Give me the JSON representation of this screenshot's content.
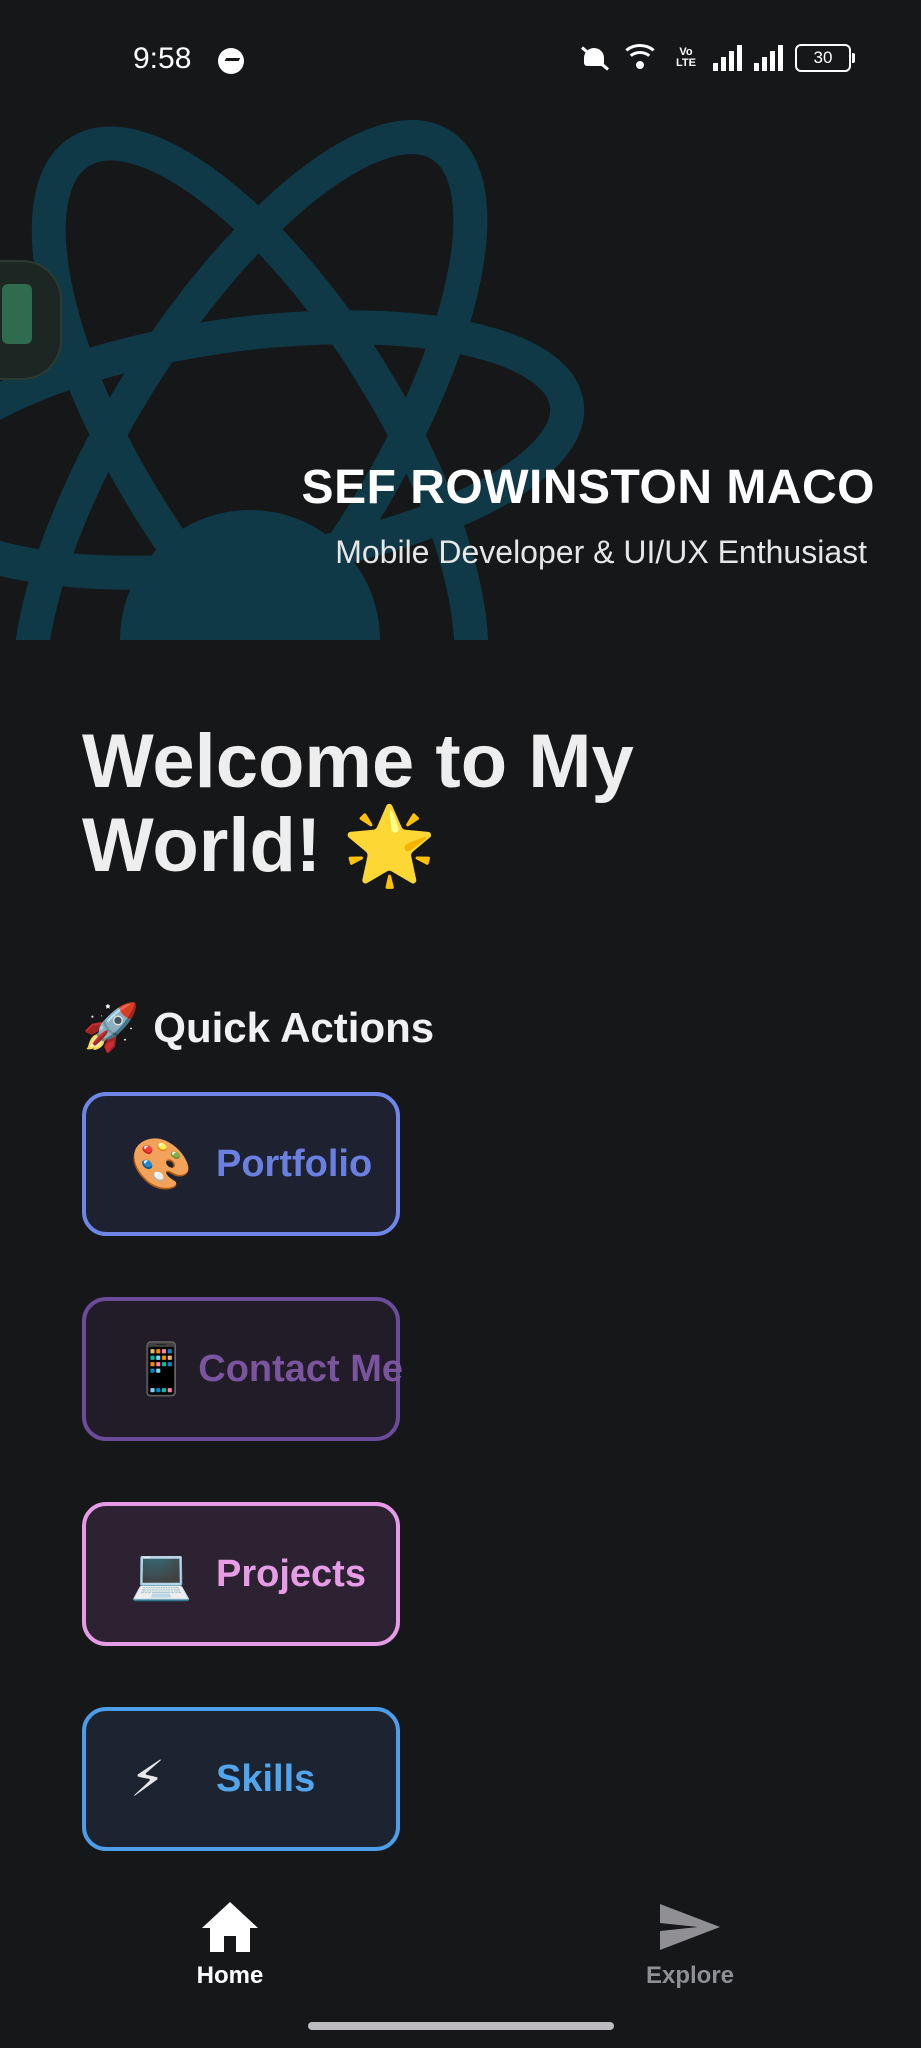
{
  "status_bar": {
    "time": "9:58",
    "volte_label": "Vo LTE",
    "battery": "30",
    "icons": [
      "messenger-icon",
      "mute-bell-icon",
      "wifi-icon",
      "volte-icon",
      "signal-icon",
      "signal-icon",
      "battery-icon"
    ]
  },
  "header": {
    "name": "SEF ROWINSTON MACO",
    "role": "Mobile Developer & UI/UX Enthusiast",
    "art": "react-atom-logo",
    "art_color": "#0f3946"
  },
  "main": {
    "welcome_line1": "Welcome to My",
    "welcome_line2": "World! 🌟",
    "section_emoji": "🚀",
    "section_title": "Quick Actions",
    "actions": [
      {
        "emoji": "🎨",
        "label": "Portfolio",
        "color": "#6a80e0"
      },
      {
        "emoji": "📱",
        "label": "Contact Me",
        "color": "#7b549f"
      },
      {
        "emoji": "💻",
        "label": "Projects",
        "color": "#e69ce6"
      },
      {
        "emoji": "⚡",
        "label": "Skills",
        "color": "#52a5ec"
      }
    ]
  },
  "bottom_nav": {
    "items": [
      {
        "label": "Home",
        "icon": "home-icon",
        "active": true
      },
      {
        "label": "Explore",
        "icon": "send-icon",
        "active": false
      }
    ]
  }
}
